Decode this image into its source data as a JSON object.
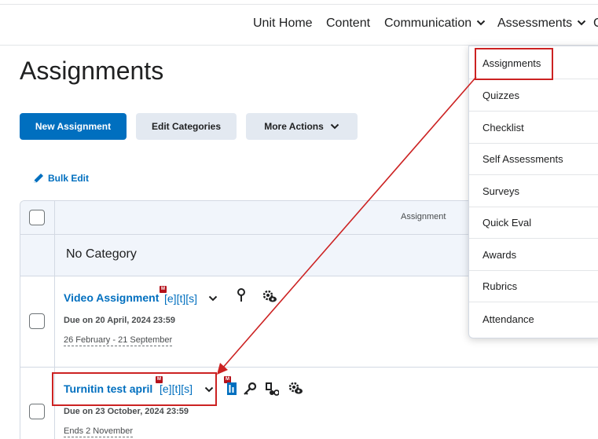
{
  "nav": {
    "items": [
      {
        "label": "Unit Home"
      },
      {
        "label": "Content"
      },
      {
        "label": "Communication"
      },
      {
        "label": "Assessments"
      },
      {
        "label": "C"
      }
    ]
  },
  "page": {
    "title": "Assignments"
  },
  "toolbar": {
    "new_label": "New Assignment",
    "edit_categories_label": "Edit Categories",
    "more_actions_label": "More Actions",
    "bulk_edit_label": "Bulk Edit"
  },
  "table": {
    "column_header": "Assignment",
    "category": "No Category",
    "assignments": [
      {
        "title": "Video Assignment",
        "tags": "[e][t][s]",
        "badge": "M",
        "due": "Due on 20 April, 2024 23:59",
        "availability": "26 February - 21 September"
      },
      {
        "title": "Turnitin test april",
        "tags": "[e][t][s]",
        "badge": "M",
        "due": "Due on 23 October, 2024 23:59",
        "availability": "Ends 2 November"
      }
    ]
  },
  "dropdown": {
    "items": [
      {
        "label": "Assignments"
      },
      {
        "label": "Quizzes"
      },
      {
        "label": "Checklist"
      },
      {
        "label": "Self Assessments"
      },
      {
        "label": "Surveys"
      },
      {
        "label": "Quick Eval"
      },
      {
        "label": "Awards"
      },
      {
        "label": "Rubrics"
      },
      {
        "label": "Attendance"
      }
    ]
  },
  "colors": {
    "primary": "#006fbf",
    "annotation": "#cc2222",
    "badge": "#b5121b",
    "secondary_button": "#e3e9f1"
  }
}
